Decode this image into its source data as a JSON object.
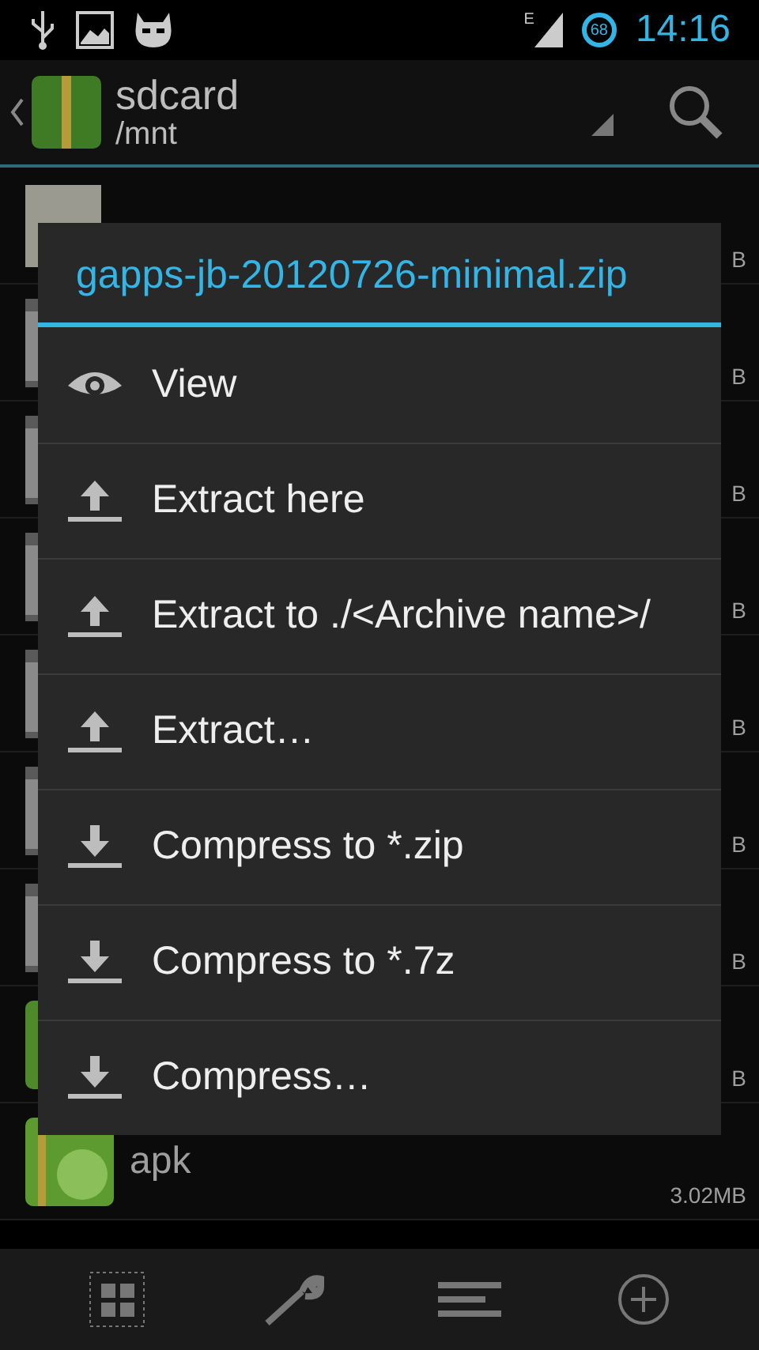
{
  "status_bar": {
    "network": "E",
    "battery": "68",
    "time": "14:16"
  },
  "action_bar": {
    "title": "sdcard",
    "subtitle": "/mnt"
  },
  "files": [
    {
      "size": "B",
      "kind": "photo"
    },
    {
      "size": "B",
      "kind": "file"
    },
    {
      "size": "B",
      "kind": "file"
    },
    {
      "size": "B",
      "kind": "file"
    },
    {
      "size": "B",
      "kind": "file"
    },
    {
      "size": "B",
      "kind": "file"
    },
    {
      "size": "B",
      "kind": "file"
    },
    {
      "size": "B",
      "kind": "archive"
    },
    {
      "name": "apk",
      "size": "3.02MB",
      "kind": "apk"
    }
  ],
  "dialog": {
    "title": "gapps-jb-20120726-minimal.zip",
    "items": [
      {
        "label": "View",
        "kind": "view"
      },
      {
        "label": "Extract here",
        "kind": "extract"
      },
      {
        "label": "Extract to ./<Archive name>/",
        "kind": "extract"
      },
      {
        "label": "Extract…",
        "kind": "extract"
      },
      {
        "label": "Compress to *.zip",
        "kind": "compress"
      },
      {
        "label": "Compress to *.7z",
        "kind": "compress"
      },
      {
        "label": "Compress…",
        "kind": "compress"
      }
    ]
  }
}
